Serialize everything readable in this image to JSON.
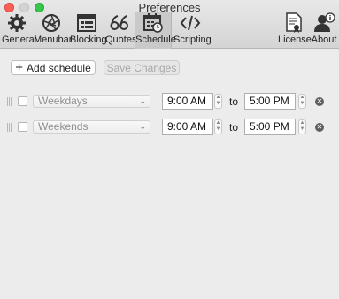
{
  "window": {
    "title": "Preferences"
  },
  "toolbar": {
    "items": [
      {
        "label": "General",
        "icon": "gear-icon"
      },
      {
        "label": "Menubar",
        "icon": "aperture-icon"
      },
      {
        "label": "Blocking",
        "icon": "browser-window-icon"
      },
      {
        "label": "Quotes",
        "icon": "quotes-icon"
      },
      {
        "label": "Schedule",
        "icon": "calendar-icon",
        "active": true
      },
      {
        "label": "Scripting",
        "icon": "code-icon"
      },
      {
        "label": "License",
        "icon": "certificate-icon"
      },
      {
        "label": "About",
        "icon": "user-info-icon"
      }
    ]
  },
  "actions": {
    "add_schedule": "Add schedule",
    "save_changes": "Save Changes"
  },
  "schedules": [
    {
      "checked": false,
      "days": "Weekdays",
      "start": "9:00 AM",
      "to": "to",
      "end": "5:00 PM"
    },
    {
      "checked": false,
      "days": "Weekends",
      "start": "9:00 AM",
      "to": "to",
      "end": "5:00 PM"
    }
  ],
  "colors": {
    "close": "#fc5f57",
    "maximize": "#34c84a",
    "active_tab": "#c9c9c9"
  }
}
